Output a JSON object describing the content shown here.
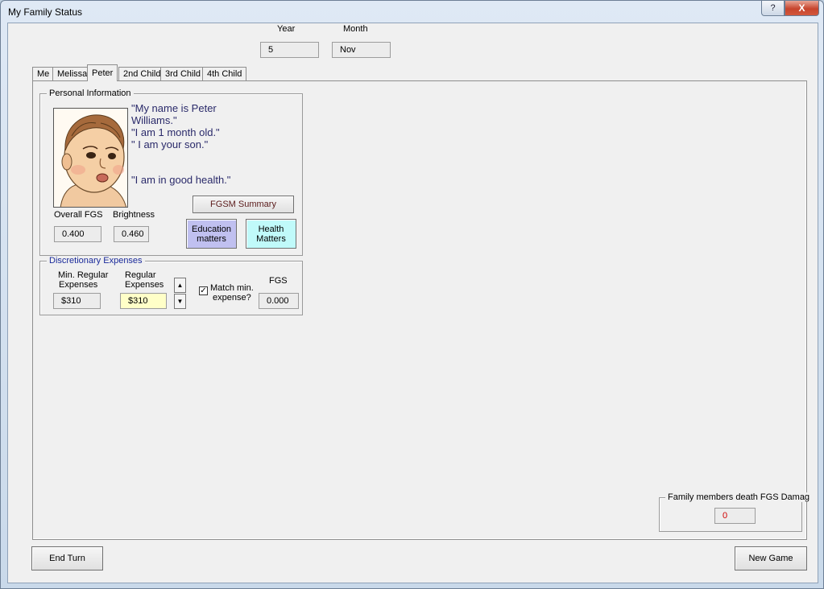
{
  "window": {
    "title": "My Family Status",
    "help_label": "?",
    "close_label": "X"
  },
  "date": {
    "year_label": "Year",
    "year_value": "5",
    "month_label": "Month",
    "month_value": "Nov"
  },
  "tabs": [
    {
      "label": "Me"
    },
    {
      "label": "Melissa"
    },
    {
      "label": "Peter"
    },
    {
      "label": "2nd Child"
    },
    {
      "label": "3rd Child"
    },
    {
      "label": "4th Child"
    }
  ],
  "personal": {
    "legend": "Personal Information",
    "quote1a": "\"My name is Peter",
    "quote1b": "Williams.\"",
    "quote2": "\"I am 1 month old.\"",
    "quote3": "\" I am your son.\"",
    "quote4": "\"I am in good health.\"",
    "fgsm_summary_label": "FGSM Summary",
    "overall_fgs_label": "Overall FGS",
    "overall_fgs_value": "0.400",
    "brightness_label": "Brightness",
    "brightness_value": "0.460",
    "education_line1": "Education",
    "education_line2": "matters",
    "health_line1": "Health",
    "health_line2": "Matters"
  },
  "discretionary": {
    "legend": "Discretionary Expenses",
    "min_regular_line1": "Min. Regular",
    "min_regular_line2": "Expenses",
    "min_regular_value": "$310",
    "regular_line1": "Regular",
    "regular_line2": "Expenses",
    "regular_value": "$310",
    "spin_up": "▲",
    "spin_down": "▼",
    "match_checked": true,
    "check_mark": "✓",
    "match_line1": "Match min.",
    "match_line2": "expense?",
    "fgs_label": "FGS",
    "fgs_value": "0.000"
  },
  "death_damage": {
    "legend": "Family members death FGS Damag",
    "value": "0"
  },
  "footer": {
    "end_turn_label": "End Turn",
    "new_game_label": "New Game"
  },
  "colors": {
    "education_button": "#c0c0f0",
    "health_button": "#c0fafa",
    "regular_expense_field": "#ffffc8",
    "damage_value_text": "#d00000"
  }
}
